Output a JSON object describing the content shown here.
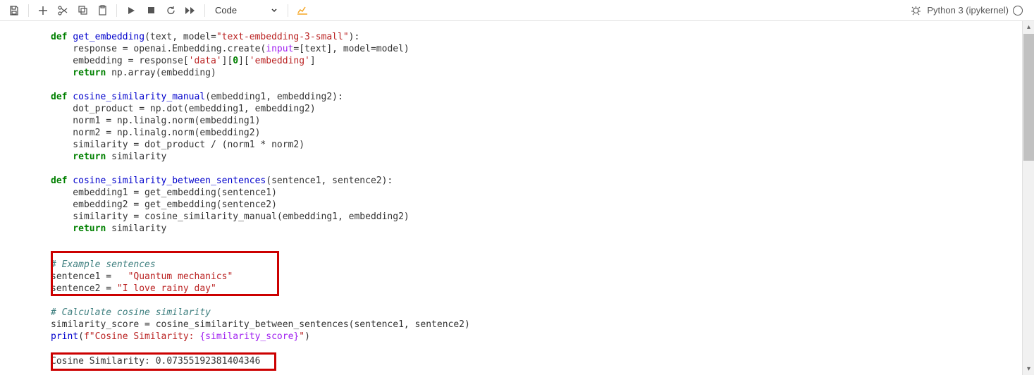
{
  "toolbar": {
    "cell_type": "Code"
  },
  "kernel": {
    "name": "Python 3 (ipykernel)"
  },
  "code": {
    "l1_def": "def",
    "l1_fn": "get_embedding",
    "l1_rest": "(text, model=",
    "l1_str": "\"text-embedding-3-small\"",
    "l1_end": "):",
    "l2a": "    response = openai.Embedding.create(",
    "l2b": "input",
    "l2c": "=[text], model=model)",
    "l3a": "    embedding = response[",
    "l3s1": "'data'",
    "l3b": "][",
    "l3n": "0",
    "l3c": "][",
    "l3s2": "'embedding'",
    "l3d": "]",
    "l4_ret": "    return",
    "l4_rest": " np.array(embedding)",
    "l6_def": "def",
    "l6_fn": " cosine_similarity_manual",
    "l6_rest": "(embedding1, embedding2):",
    "l7": "    dot_product = np.dot(embedding1, embedding2)",
    "l8": "    norm1 = np.linalg.norm(embedding1)",
    "l9": "    norm2 = np.linalg.norm(embedding2)",
    "l10": "    similarity = dot_product / (norm1 * norm2)",
    "l11_ret": "    return",
    "l11_rest": " similarity",
    "l13_def": "def",
    "l13_fn": " cosine_similarity_between_sentences",
    "l13_rest": "(sentence1, sentence2):",
    "l14": "    embedding1 = get_embedding(sentence1)",
    "l15": "    embedding2 = get_embedding(sentence2)",
    "l16": "    similarity = cosine_similarity_manual(embedding1, embedding2)",
    "l17_ret": "    return",
    "l17_rest": " similarity",
    "l20_cmt": "# Example sentences",
    "l21a": "sentence1 =   ",
    "l21s": "\"Quantum mechanics\"",
    "l22a": "sentence2 = ",
    "l22s": "\"I love rainy day\"",
    "l24_cmt": "# Calculate cosine similarity",
    "l25": "similarity_score = cosine_similarity_between_sentences(sentence1, sentence2)",
    "l26_fn": "print",
    "l26a": "(",
    "l26f": "f\"Cosine Similarity: ",
    "l26b": "{similarity_score}",
    "l26c": "\"",
    "l26d": ")"
  },
  "output": {
    "line": "Cosine Similarity: 0.07355192381404346"
  }
}
